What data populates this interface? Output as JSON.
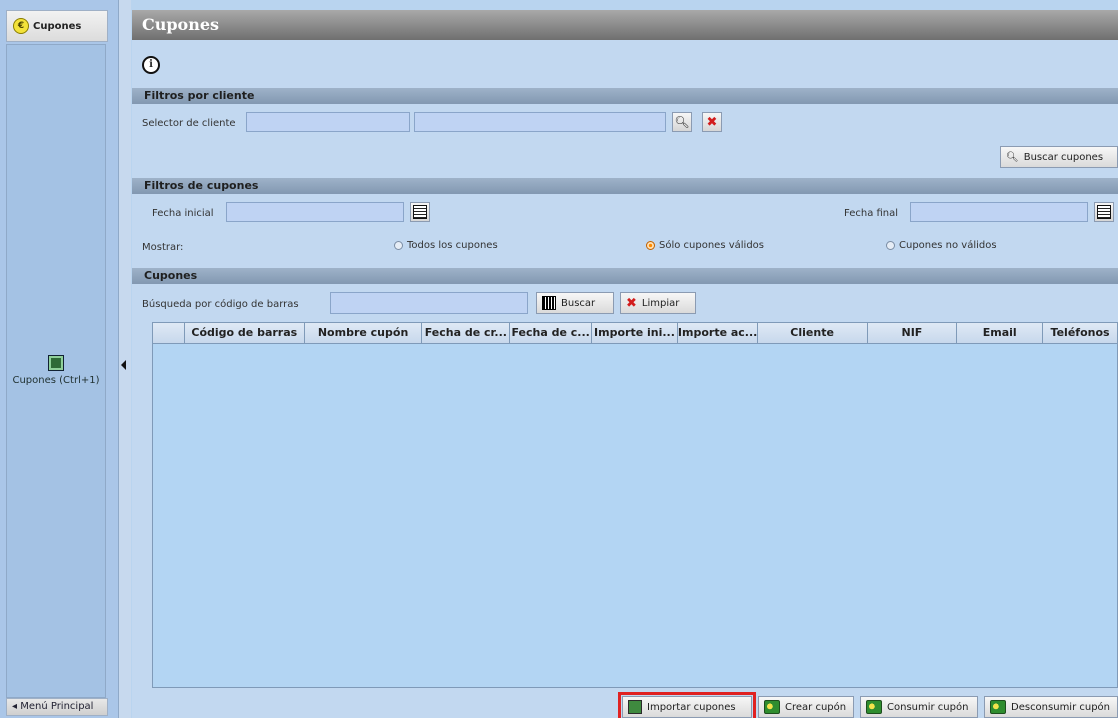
{
  "sidebar": {
    "tab_label": "Cupones",
    "item_label": "Cupones (Ctrl+1)",
    "footer_label": "Menú Principal"
  },
  "main": {
    "title": "Cupones",
    "info_icon": "info-icon",
    "sections": {
      "clientes": "Filtros por cliente",
      "cupones_filtros": "Filtros de cupones",
      "cupones": "Cupones"
    },
    "cliente_selector": {
      "label": "Selector de cliente"
    },
    "buscar_cupones": "Buscar cupones",
    "fecha_inicial": "Fecha inicial",
    "fecha_final": "Fecha final",
    "mostrar": "Mostrar:",
    "radios": [
      {
        "label": "Todos los cupones",
        "selected": false
      },
      {
        "label": "Sólo cupones válidos",
        "selected": true
      },
      {
        "label": "Cupones no válidos",
        "selected": false
      }
    ],
    "barcode_search": {
      "label": "Búsqueda por código de barras",
      "buscar": "Buscar",
      "limpiar": "Limpiar"
    },
    "table_columns": [
      "",
      "Código de barras",
      "Nombre cupón",
      "Fecha de cr...",
      "Fecha de c...",
      "Importe ini...",
      "Importe ac...",
      "Cliente",
      "NIF",
      "Email",
      "Teléfonos"
    ],
    "bottom_buttons": {
      "importar": "Importar cupones",
      "crear": "Crear cupón",
      "consumir": "Consumir cupón",
      "desconsumir": "Desconsumir cupón"
    }
  }
}
